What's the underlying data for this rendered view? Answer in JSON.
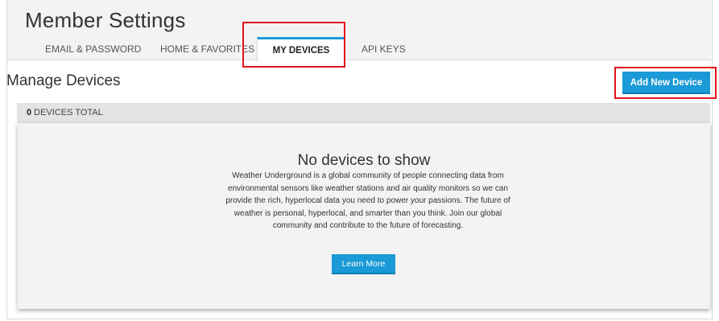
{
  "header": {
    "title": "Member Settings",
    "tabs": [
      {
        "label": "EMAIL & PASSWORD"
      },
      {
        "label": "HOME & FAVORITES"
      },
      {
        "label": "MY DEVICES"
      },
      {
        "label": "API KEYS"
      }
    ],
    "active_tab": "MY DEVICES"
  },
  "devices": {
    "section_title": "Manage Devices",
    "add_button_label": "Add New Device",
    "count": "0",
    "count_suffix": " DEVICES TOTAL",
    "empty_title": "No devices to show",
    "empty_description": "Weather Underground is a global community of people connecting data from environmental sensors like weather stations and air quality monitors so we can provide the rich, hyperlocal data you need to power your passions. The future of weather is personal, hyperlocal, and smarter than you think. Join our global community and contribute to the future of forecasting.",
    "learn_more_label": "Learn More"
  },
  "colors": {
    "accent": "#1a9ad6",
    "highlight": "#e0141e"
  }
}
